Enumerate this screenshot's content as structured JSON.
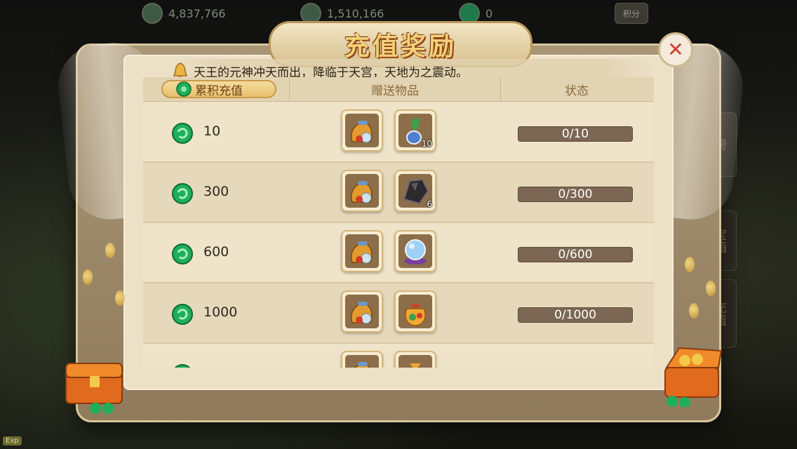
{
  "currencies": [
    {
      "icon": "silver-coin-icon",
      "value": "4,837,766"
    },
    {
      "icon": "ingot-icon",
      "value": "1,510,166"
    },
    {
      "icon": "jade-icon",
      "value": "0"
    }
  ],
  "score_button": "积分",
  "exp_badge": "Exp",
  "side_tabs": [
    "榜",
    "宝箱",
    "充值"
  ],
  "modal": {
    "title": "充值奖励",
    "close_icon": "close-icon",
    "marquee": "天王的元神冲天而出，降临于天宫，天地为之震动。",
    "headers": {
      "recharge": "累积充值",
      "gifts": "赠送物品",
      "status": "状态"
    },
    "rows": [
      {
        "amount": "10",
        "items": [
          {
            "icon": "gift-bag-icon",
            "qty": ""
          },
          {
            "icon": "herb-potion-icon",
            "qty": "10"
          }
        ],
        "status": "0/10",
        "progress": 0
      },
      {
        "amount": "300",
        "items": [
          {
            "icon": "gift-bag-icon",
            "qty": ""
          },
          {
            "icon": "dark-ore-icon",
            "qty": "6"
          }
        ],
        "status": "0/300",
        "progress": 0
      },
      {
        "amount": "600",
        "items": [
          {
            "icon": "gift-bag-icon",
            "qty": ""
          },
          {
            "icon": "crystal-orb-icon",
            "qty": ""
          }
        ],
        "status": "0/600",
        "progress": 0
      },
      {
        "amount": "1000",
        "items": [
          {
            "icon": "gift-bag-icon",
            "qty": ""
          },
          {
            "icon": "treasure-pouch-icon",
            "qty": ""
          }
        ],
        "status": "0/1000",
        "progress": 0
      },
      {
        "amount": "",
        "items": [
          {
            "icon": "gift-bag-icon",
            "qty": ""
          },
          {
            "icon": "red-pouch-icon",
            "qty": ""
          }
        ],
        "status": "",
        "progress": 0
      }
    ]
  },
  "colors": {
    "panel": "#ece0c7",
    "status_bar": "#7b6753",
    "jade": "#1fae5a",
    "close": "#d23a2c"
  }
}
